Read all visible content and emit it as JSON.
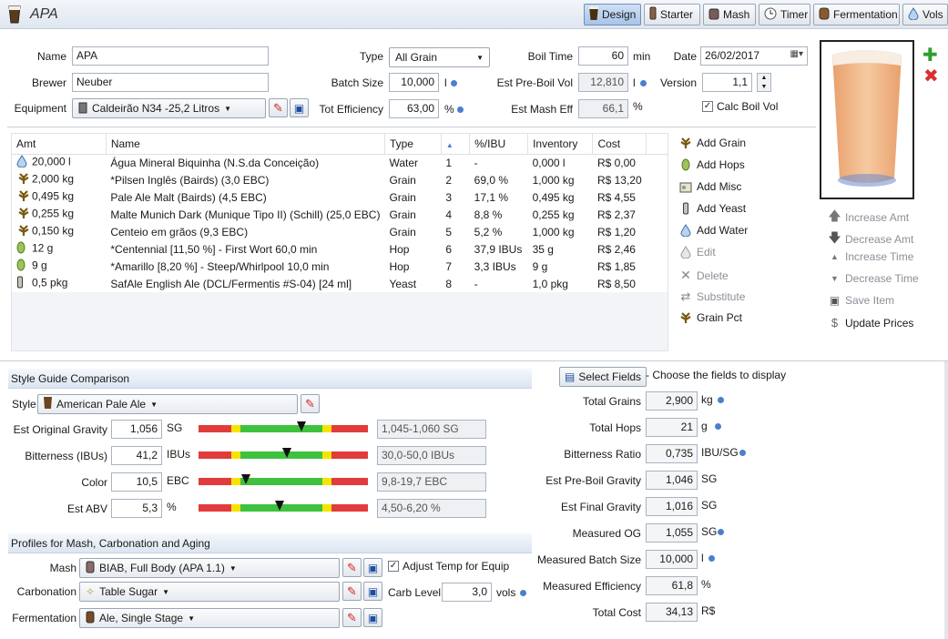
{
  "recipe_title": "APA",
  "tabs": [
    {
      "label": "Design",
      "icon": "pint-glass-icon",
      "active": true
    },
    {
      "label": "Starter",
      "icon": "yeast-vial-icon"
    },
    {
      "label": "Mash",
      "icon": "mash-tun-icon"
    },
    {
      "label": "Timer",
      "icon": "clock-icon"
    },
    {
      "label": "Fermentation",
      "icon": "fermenter-icon"
    },
    {
      "label": "Vols",
      "icon": "water-drop-icon"
    }
  ],
  "form": {
    "name_label": "Name",
    "name_value": "APA",
    "brewer_label": "Brewer",
    "brewer_value": "Neuber",
    "equipment_label": "Equipment",
    "equipment_value": "Caldeirão N34 -25,2 Litros",
    "type_label": "Type",
    "type_value": "All Grain",
    "batch_size_label": "Batch Size",
    "batch_size_value": "10,000",
    "batch_size_unit": "l",
    "tot_eff_label": "Tot Efficiency",
    "tot_eff_value": "63,00",
    "tot_eff_unit": "%",
    "boil_time_label": "Boil Time",
    "boil_time_value": "60",
    "boil_time_unit": "min",
    "pre_boil_label": "Est Pre-Boil Vol",
    "pre_boil_value": "12,810",
    "pre_boil_unit": "l",
    "mash_eff_label": "Est Mash Eff",
    "mash_eff_value": "66,1",
    "mash_eff_unit": "%",
    "date_label": "Date",
    "date_value": "26/02/2017",
    "version_label": "Version",
    "version_value": "1,1",
    "calc_boil_label": "Calc Boil Vol",
    "calc_boil_checked": true
  },
  "ingredients": {
    "columns": [
      "Amt",
      "Name",
      "Type",
      "",
      "%/IBU",
      "Inventory",
      "Cost"
    ],
    "rows": [
      {
        "icon": "water-icon",
        "amt": "20,000 l",
        "name": "Água Mineral Biquinha (N.S.da Conceição)",
        "type": "Water",
        "order": "1",
        "pct": "-",
        "inv": "0,000 l",
        "cost": "R$ 0,00"
      },
      {
        "icon": "grain-icon",
        "amt": "2,000 kg",
        "name": "*Pilsen Inglês (Bairds) (3,0 EBC)",
        "type": "Grain",
        "order": "2",
        "pct": "69,0 %",
        "inv": "1,000 kg",
        "cost": "R$ 13,20"
      },
      {
        "icon": "grain-icon",
        "amt": "0,495 kg",
        "name": "Pale Ale Malt (Bairds) (4,5 EBC)",
        "type": "Grain",
        "order": "3",
        "pct": "17,1 %",
        "inv": "0,495 kg",
        "cost": "R$ 4,55"
      },
      {
        "icon": "grain-icon",
        "amt": "0,255 kg",
        "name": "Malte Munich Dark (Munique Tipo II) (Schill) (25,0 EBC)",
        "type": "Grain",
        "order": "4",
        "pct": "8,8 %",
        "inv": "0,255 kg",
        "cost": "R$ 2,37"
      },
      {
        "icon": "grain-icon",
        "amt": "0,150 kg",
        "name": "Centeio em grãos (9,3 EBC)",
        "type": "Grain",
        "order": "5",
        "pct": "5,2 %",
        "inv": "1,000 kg",
        "cost": "R$ 1,20"
      },
      {
        "icon": "hop-icon",
        "amt": "12 g",
        "name": "*Centennial [11,50 %] - First Wort 60,0 min",
        "type": "Hop",
        "order": "6",
        "pct": "37,9 IBUs",
        "inv": "35 g",
        "cost": "R$ 2,46"
      },
      {
        "icon": "hop-icon",
        "amt": "9 g",
        "name": "*Amarillo [8,20 %] - Steep/Whirlpool  10,0 min",
        "type": "Hop",
        "order": "7",
        "pct": "3,3 IBUs",
        "inv": "9 g",
        "cost": "R$ 1,85"
      },
      {
        "icon": "yeast-icon",
        "amt": "0,5 pkg",
        "name": "SafAle English Ale (DCL/Fermentis #S-04) [24 ml]",
        "type": "Yeast",
        "order": "8",
        "pct": "-",
        "inv": "1,0 pkg",
        "cost": "R$ 8,50"
      }
    ]
  },
  "actions_a": [
    {
      "label": "Add Grain",
      "icon": "grain-icon",
      "enabled": true
    },
    {
      "label": "Add Hops",
      "icon": "hop-icon",
      "enabled": true
    },
    {
      "label": "Add Misc",
      "icon": "misc-icon",
      "enabled": true
    },
    {
      "label": "Add Yeast",
      "icon": "yeast-icon",
      "enabled": true
    },
    {
      "label": "Add Water",
      "icon": "water-icon",
      "enabled": true
    },
    {
      "label": "Edit",
      "icon": "edit-icon",
      "enabled": false
    },
    {
      "label": "Delete",
      "icon": "delete-icon",
      "enabled": false
    },
    {
      "label": "Substitute",
      "icon": "substitute-icon",
      "enabled": false
    },
    {
      "label": "Grain Pct",
      "icon": "grain-icon",
      "enabled": true
    }
  ],
  "actions_b": [
    {
      "label": "Increase Amt",
      "icon": "arrow-up-icon"
    },
    {
      "label": "Decrease Amt",
      "icon": "arrow-down-icon"
    },
    {
      "label": "Increase Time",
      "icon": "triangle-up-icon"
    },
    {
      "label": "Decrease Time",
      "icon": "triangle-down-icon"
    },
    {
      "label": "Save Item",
      "icon": "save-icon"
    },
    {
      "label": "Update Prices",
      "icon": "dollar-icon"
    }
  ],
  "style_section": {
    "title": "Style Guide Comparison",
    "style_label": "Style",
    "style_value": "American Pale Ale",
    "rows": [
      {
        "label": "Est Original Gravity",
        "value": "1,056",
        "unit": "SG",
        "range": "1,045-1,060 SG",
        "marker": 0.61
      },
      {
        "label": "Bitterness (IBUs)",
        "value": "41,2",
        "unit": "IBUs",
        "range": "30,0-50,0 IBUs",
        "marker": 0.52
      },
      {
        "label": "Color",
        "value": "10,5",
        "unit": "EBC",
        "range": "9,8-19,7 EBC",
        "marker": 0.28
      },
      {
        "label": "Est ABV",
        "value": "5,3",
        "unit": "%",
        "range": "4,50-6,20 %",
        "marker": 0.48
      }
    ]
  },
  "profiles_section": {
    "title": "Profiles for Mash, Carbonation and Aging",
    "mash_label": "Mash",
    "mash_value": "BIAB, Full Body (APA 1.1)",
    "adjust_temp_label": "Adjust Temp for Equip",
    "carb_label": "Carbonation",
    "carb_value": "Table Sugar",
    "carb_level_label": "Carb Level",
    "carb_level_value": "3,0",
    "carb_level_unit": "vols",
    "ferm_label": "Fermentation",
    "ferm_value": "Ale, Single Stage"
  },
  "stats": {
    "select_fields_label": "Select Fields",
    "select_fields_hint": "- Choose the fields to display",
    "rows": [
      {
        "label": "Total Grains",
        "value": "2,900",
        "unit": "kg",
        "dot": true
      },
      {
        "label": "Total Hops",
        "value": "21",
        "unit": "g",
        "dot": true
      },
      {
        "label": "Bitterness Ratio",
        "value": "0,735",
        "unit": "IBU/SG",
        "dot": true
      },
      {
        "label": "Est Pre-Boil Gravity",
        "value": "1,046",
        "unit": "SG",
        "dot": false
      },
      {
        "label": "Est Final Gravity",
        "value": "1,016",
        "unit": "SG",
        "dot": false
      },
      {
        "label": "Measured OG",
        "value": "1,055",
        "unit": "SG",
        "dot": true
      },
      {
        "label": "Measured Batch Size",
        "value": "10,000",
        "unit": "l",
        "dot": true
      },
      {
        "label": "Measured Efficiency",
        "value": "61,8",
        "unit": "%",
        "dot": false
      },
      {
        "label": "Total Cost",
        "value": "34,13",
        "unit": "R$",
        "dot": false
      }
    ]
  },
  "colors": {
    "accent": "#4a7fd0",
    "beer": "#f2b889",
    "add_green": "#2e9e2e",
    "delete_red": "#d93030"
  }
}
